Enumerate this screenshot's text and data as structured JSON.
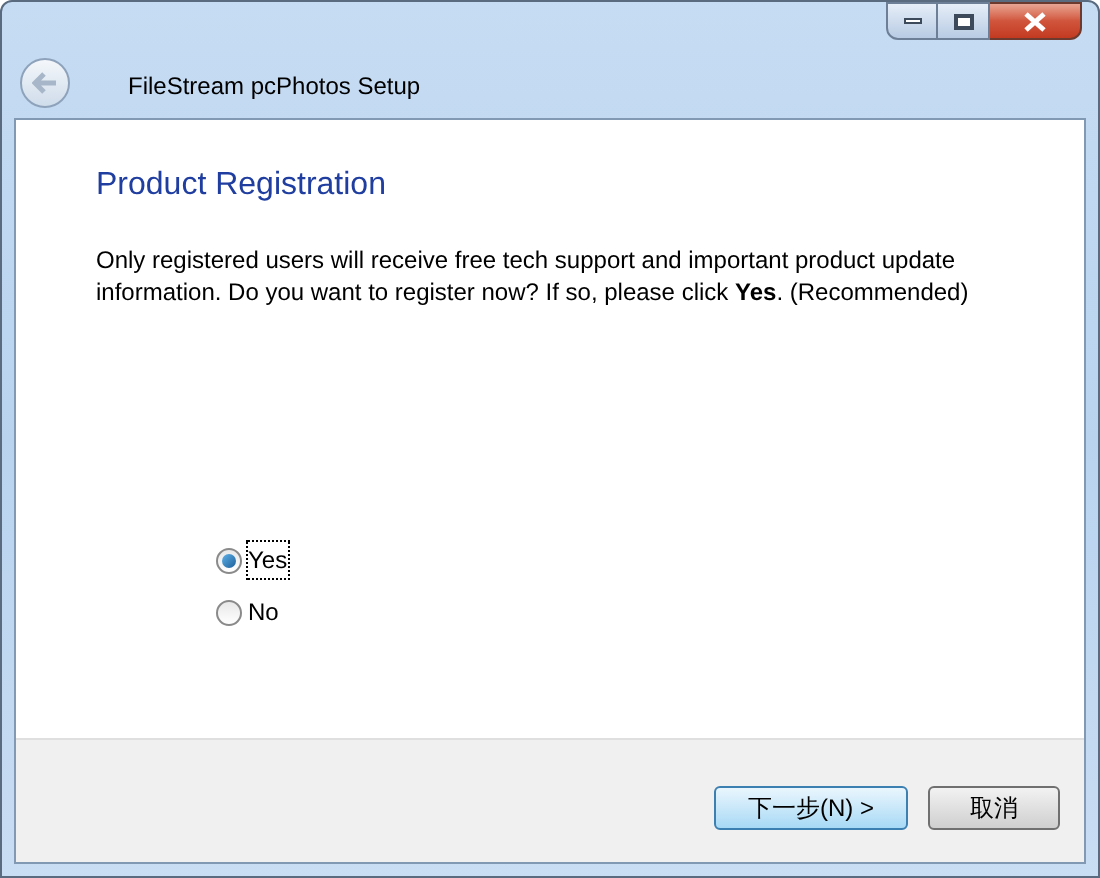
{
  "window": {
    "title": "FileStream pcPhotos Setup"
  },
  "heading": "Product Registration",
  "description": "Only registered users will receive free tech support and important product update information. Do you want to register now? If so, please click **Yes**. (Recommended)",
  "options": [
    {
      "label": "Yes",
      "selected": true
    },
    {
      "label": "No",
      "selected": false
    }
  ],
  "buttons": [
    {
      "label": "下一步(N) >",
      "kind": "primary"
    },
    {
      "label": "取消",
      "kind": "normal"
    }
  ]
}
